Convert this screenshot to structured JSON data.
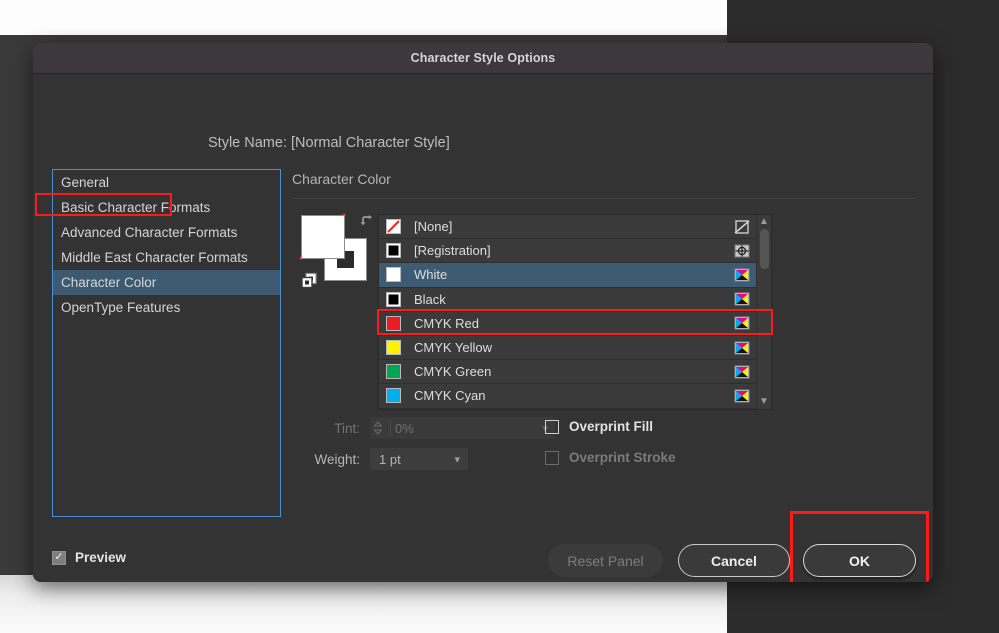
{
  "window": {
    "title": "Character Style Options"
  },
  "style_name_line": "Style Name: [Normal Character Style]",
  "sidebar": {
    "items": [
      {
        "label": "General",
        "selected": false
      },
      {
        "label": "Basic Character Formats",
        "selected": false
      },
      {
        "label": "Advanced Character Formats",
        "selected": false
      },
      {
        "label": "Middle East Character Formats",
        "selected": false
      },
      {
        "label": "Character Color",
        "selected": true
      },
      {
        "label": "OpenType Features",
        "selected": false
      }
    ]
  },
  "pane": {
    "title": "Character Color",
    "swatches": [
      {
        "name": "[None]",
        "chip": "none",
        "color": "#ffffff",
        "mode_icon": "none-icon",
        "selected": false
      },
      {
        "name": "[Registration]",
        "chip": "registration",
        "color": "#000000",
        "mode_icon": "registration-icon",
        "selected": false
      },
      {
        "name": "White",
        "chip": "solid",
        "color": "#ffffff",
        "mode_icon": "cmyk-icon",
        "selected": true
      },
      {
        "name": "Black",
        "chip": "solid",
        "color": "#000000",
        "mode_icon": "cmyk-icon",
        "selected": false
      },
      {
        "name": "CMYK Red",
        "chip": "solid",
        "color": "#ed1c24",
        "mode_icon": "cmyk-icon",
        "selected": false
      },
      {
        "name": "CMYK Yellow",
        "chip": "solid",
        "color": "#fff200",
        "mode_icon": "cmyk-icon",
        "selected": false
      },
      {
        "name": "CMYK Green",
        "chip": "solid",
        "color": "#00a651",
        "mode_icon": "cmyk-icon",
        "selected": false
      },
      {
        "name": "CMYK Cyan",
        "chip": "solid",
        "color": "#00aeef",
        "mode_icon": "cmyk-icon",
        "selected": false
      }
    ],
    "tint": {
      "label": "Tint:",
      "value": "0%",
      "enabled": false
    },
    "weight": {
      "label": "Weight:",
      "value": "1 pt",
      "enabled": true
    },
    "overprint_fill": {
      "label": "Overprint Fill",
      "checked": false,
      "enabled": true
    },
    "overprint_stroke": {
      "label": "Overprint Stroke",
      "checked": false,
      "enabled": false
    }
  },
  "footer": {
    "preview_label": "Preview",
    "preview_checked": true,
    "preview_check_glyph": "✓",
    "reset_label": "Reset Panel",
    "cancel_label": "Cancel",
    "ok_label": "OK"
  },
  "annotations": {
    "highlight_color": "#ff1a1a",
    "selection_color": "#3d5b73",
    "focus_border_color": "#4a8fd4"
  }
}
